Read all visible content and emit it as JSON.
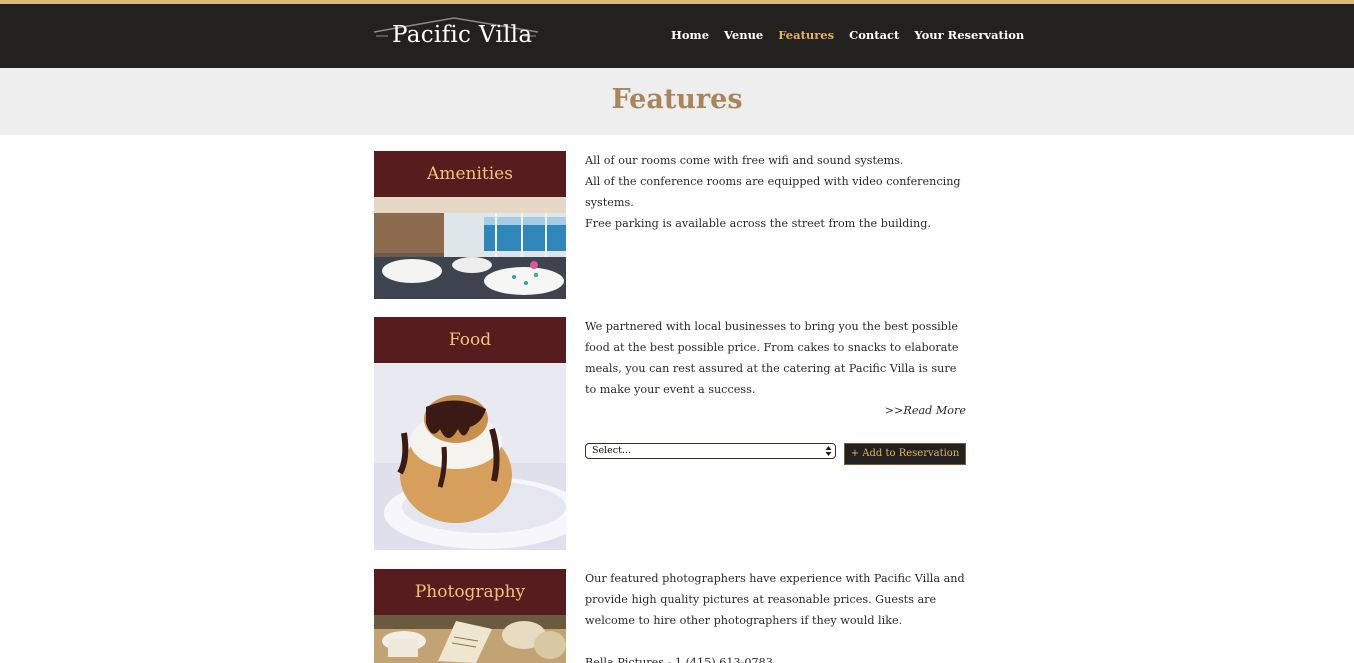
{
  "brand": {
    "name": "Pacific Villa"
  },
  "nav": {
    "items": [
      {
        "label": "Home",
        "active": false
      },
      {
        "label": "Venue",
        "active": false
      },
      {
        "label": "Features",
        "active": true
      },
      {
        "label": "Contact",
        "active": false
      },
      {
        "label": "Your Reservation",
        "active": false
      }
    ]
  },
  "page": {
    "title": "Features"
  },
  "features": [
    {
      "title": "Amenities",
      "paragraphs": [
        "All of our rooms come with free wifi and sound systems.",
        "All of the conference rooms are equipped with video conferencing systems.",
        "Free parking is available across the street from the building."
      ]
    },
    {
      "title": "Food",
      "paragraphs": [
        "We partnered with local businesses to bring you the best possible food at the best possible price. From cakes to snacks to elaborate meals, you can rest assured at the catering at Pacific Villa is sure to make your event a success."
      ],
      "read_more": ">>Read More",
      "select_value": "Select...",
      "add_button": "+ Add to Reservation"
    },
    {
      "title": "Photography",
      "paragraphs": [
        "Our featured photographers have experience with Pacific Villa and provide high quality pictures at reasonable prices. Guests are welcome to hire other photographers if they would like.",
        "Bella Pictures - 1 (415) 613-0783"
      ]
    }
  ],
  "colors": {
    "header_bg": "#232120",
    "header_accent": "#d9b77e",
    "nav_active": "#e6b35c",
    "title_gold": "#a8865a",
    "feature_head_bg": "#561c1e",
    "feature_head_text": "#f0c47c"
  }
}
